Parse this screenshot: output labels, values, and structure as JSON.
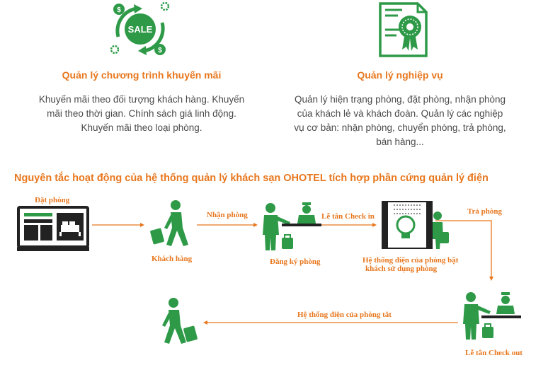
{
  "features": [
    {
      "icon": "sale-cycle-icon",
      "title": "Quản lý chương trình khuyến mãi",
      "lines": [
        "Khuyến mãi theo đối tượng khách hàng. Khuyến",
        "mãi theo thời gian. Chính sách giá linh động.",
        "Khuyến mãi theo loại phòng."
      ],
      "badge": "SALE"
    },
    {
      "icon": "certificate-document-icon",
      "title": "Quản lý nghiệp vụ",
      "lines": [
        "Quản lý hiện trạng phòng, đặt phòng, nhận phòng",
        "của khách lẻ và khách đoàn. Quản lý các nghiệp",
        "vụ cơ bản: nhận phòng, chuyển phòng, trả phòng,",
        "bán hàng..."
      ]
    }
  ],
  "flow": {
    "heading": "Nguyên tắc hoạt động của hệ thống quản lý khách sạn OHOTEL tích hợp phần cứng quản lý điện",
    "booking_label": "Đặt phòng",
    "guest_label": "Khách hàng",
    "receive_label": "Nhận phòng",
    "register_label": "Đăng ký phòng",
    "checkin_label": "Lễ tân Check in",
    "power_on_label_1": "Hệ thống điện của phòng bật",
    "power_on_label_2": "khách sử dụng phòng",
    "checkout_arrow_label": "Trả phòng",
    "checkout_label": "Lễ tân Check out",
    "power_off_label": "Hệ thống điện của phòng tắt"
  },
  "colors": {
    "accent": "#e8771e",
    "green": "#2e9a48",
    "dark": "#222222"
  }
}
